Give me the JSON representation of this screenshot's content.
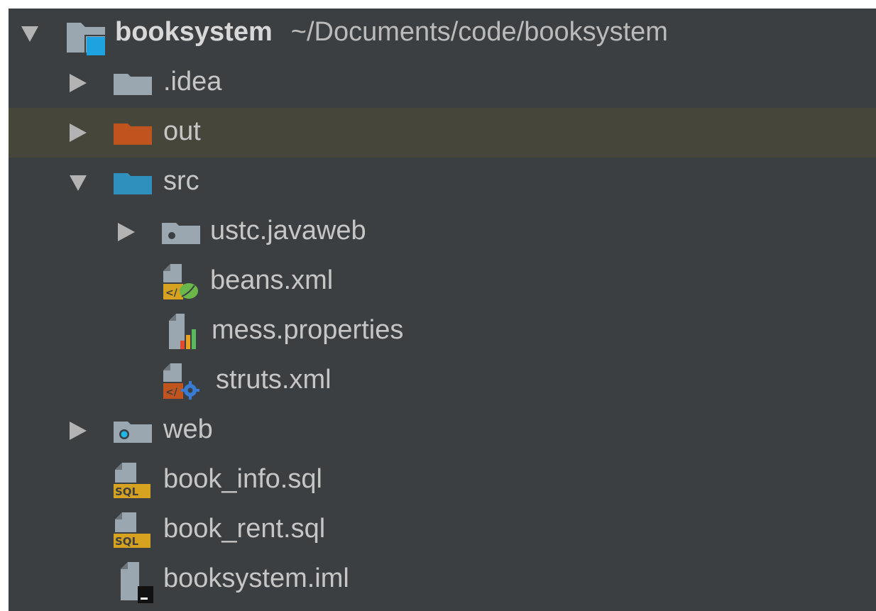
{
  "tree": {
    "root": {
      "name": "booksystem",
      "path": "~/Documents/code/booksystem",
      "icon": "module-folder-icon",
      "expanded": true
    },
    "items": [
      {
        "label": ".idea",
        "icon": "folder-icon",
        "expanded": false
      },
      {
        "label": "out",
        "icon": "excluded-folder-icon",
        "expanded": false,
        "selected": true
      },
      {
        "label": "src",
        "icon": "source-folder-icon",
        "expanded": true
      },
      {
        "label": "ustc.javaweb",
        "icon": "package-icon",
        "expanded": false
      },
      {
        "label": "beans.xml",
        "icon": "spring-xml-file-icon"
      },
      {
        "label": "mess.properties",
        "icon": "properties-file-icon"
      },
      {
        "label": "struts.xml",
        "icon": "struts-xml-file-icon"
      },
      {
        "label": "web",
        "icon": "web-folder-icon",
        "expanded": false
      },
      {
        "label": "book_info.sql",
        "icon": "sql-file-icon"
      },
      {
        "label": "book_rent.sql",
        "icon": "sql-file-icon"
      },
      {
        "label": "booksystem.iml",
        "icon": "iml-file-icon"
      }
    ]
  },
  "colors": {
    "panel_bg": "#3c3f41",
    "selected_row_bg": "#47463b",
    "folder_gray": "#9aa7b0",
    "excluded_orange": "#c0541f",
    "source_blue": "#2f8fbd",
    "module_cyan": "#1fa2e0",
    "sql_yellow": "#d6a21f"
  }
}
